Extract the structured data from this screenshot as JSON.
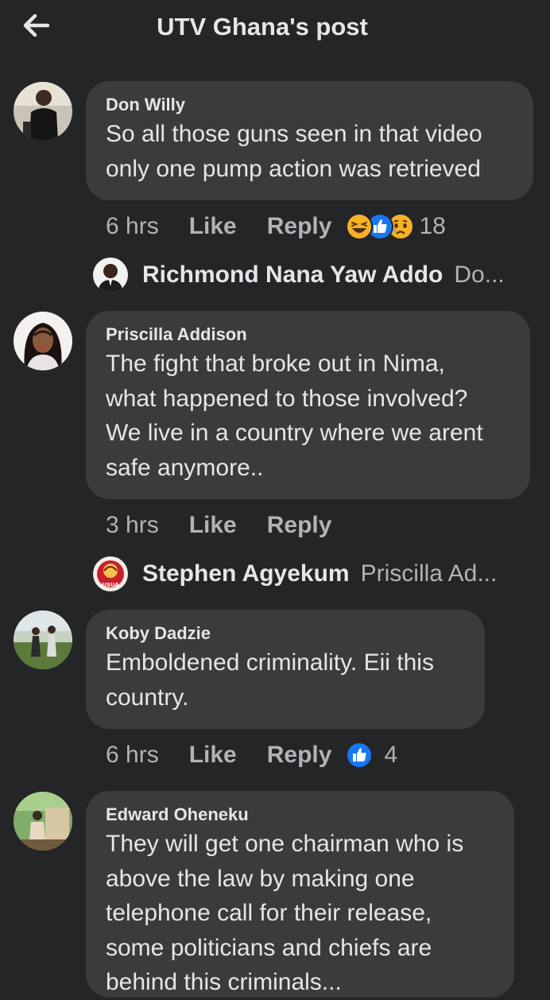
{
  "header": {
    "title": "UTV Ghana's post",
    "back_icon": "arrow-left-icon"
  },
  "comments": [
    {
      "author": "Don Willy",
      "lines": [
        "So all those guns seen in that video",
        "only one pump action was retrieved"
      ],
      "time": "6 hrs",
      "like_label": "Like",
      "reply_label": "Reply",
      "reaction_icons": [
        "haha-icon",
        "like-icon",
        "sad-icon"
      ],
      "reaction_count": "18",
      "reply": {
        "name": "Richmond Nana Yaw Addo",
        "snippet": "Do..."
      }
    },
    {
      "author": "Priscilla Addison",
      "lines": [
        "The fight that broke out in Nima,",
        "what happened to those involved?",
        "We live in a country where we arent",
        "safe anymore.."
      ],
      "time": "3 hrs",
      "like_label": "Like",
      "reply_label": "Reply",
      "reply": {
        "name": "Stephen Agyekum",
        "snippet": "Priscilla Ad...",
        "avatar_text": "USUA"
      }
    },
    {
      "author": "Koby Dadzie",
      "lines": [
        "Emboldened criminality. Eii this",
        "country."
      ],
      "time": "6 hrs",
      "like_label": "Like",
      "reply_label": "Reply",
      "reaction_icons": [
        "like-icon"
      ],
      "reaction_count": "4"
    },
    {
      "author": "Edward Oheneku",
      "lines": [
        "They will get one chairman who is",
        "above the law by making one",
        "telephone call for their release,",
        "some politicians and chiefs are",
        "behind this criminals..."
      ]
    }
  ],
  "colors": {
    "background": "#242526",
    "bubble": "#3a3b3c",
    "primary_text": "#e4e6eb",
    "secondary_text": "#b0b3b8",
    "like_blue": "#1877f2",
    "haha_yellow": "#f7b125"
  }
}
